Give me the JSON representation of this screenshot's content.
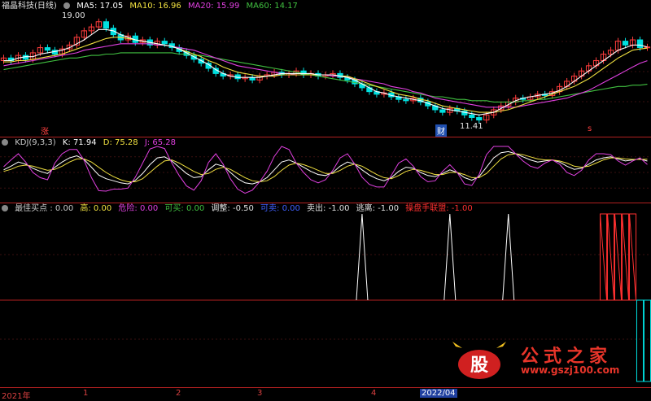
{
  "main": {
    "title": "福晶科技(日线)",
    "ma5": "MA5: 17.05",
    "ma10": "MA10: 16.96",
    "ma20": "MA20: 15.99",
    "ma60": "MA60: 14.17",
    "high_label": "19.00",
    "low_label": "11.41",
    "marker_zhang": "涨",
    "marker_cai": "财",
    "marker_s": "s"
  },
  "kdj": {
    "name": "KDJ(9,3,3)",
    "k": "K: 71.94",
    "d": "D: 75.28",
    "j": "J: 65.28"
  },
  "ind": {
    "name": "最佳买点 : 0.00",
    "gao": "高: 0.00",
    "wx": "危险: 0.00",
    "km": "可买: 0.00",
    "tz": "调整: -0.50",
    "km2": "可卖: 0.00",
    "mc": "卖出: -1.00",
    "tj": "逃离: -1.00",
    "cp": "操盘手联盟: -1.00"
  },
  "axis": {
    "labels": [
      "2021年",
      "1",
      "2",
      "3",
      "4",
      "2022/04"
    ]
  },
  "watermark": {
    "big": "公式之家",
    "url": "www.gszj100.com",
    "logo": "股"
  },
  "colors": {
    "up": "#ff3c3c",
    "down": "#00e0e0",
    "ma5": "#ffffff",
    "ma10": "#f0e040",
    "ma20": "#e040e0",
    "ma60": "#40c040"
  },
  "chart_data": [
    {
      "type": "candlestick",
      "title": "福晶科技(日线)",
      "price_range": [
        10.5,
        19.8
      ],
      "close": [
        16.2,
        16.0,
        16.4,
        16.1,
        16.6,
        17.0,
        16.8,
        16.5,
        16.9,
        17.2,
        17.8,
        18.3,
        18.6,
        19.0,
        18.5,
        18.0,
        17.6,
        17.9,
        17.4,
        17.6,
        17.2,
        17.5,
        17.3,
        17.0,
        16.7,
        16.4,
        16.1,
        15.8,
        15.4,
        15.0,
        14.8,
        14.9,
        14.6,
        14.7,
        14.5,
        14.8,
        14.9,
        15.1,
        14.9,
        15.0,
        15.2,
        14.9,
        15.0,
        14.8,
        14.9,
        15.0,
        14.7,
        14.5,
        14.2,
        13.9,
        13.6,
        13.4,
        13.5,
        13.2,
        13.0,
        12.9,
        13.1,
        12.8,
        12.5,
        12.2,
        12.0,
        12.3,
        12.1,
        11.8,
        11.6,
        11.41,
        11.8,
        12.2,
        12.5,
        12.8,
        13.1,
        13.0,
        13.2,
        13.4,
        13.3,
        13.6,
        14.0,
        14.4,
        14.8,
        15.2,
        15.6,
        16.0,
        16.5,
        16.8,
        17.5,
        17.2,
        17.6,
        17.0,
        17.05
      ],
      "ma5": [
        16.0,
        16.0,
        16.2,
        16.3,
        16.3,
        16.5,
        16.6,
        16.7,
        16.8,
        17.0,
        17.3,
        17.6,
        18.0,
        18.4,
        18.4,
        18.3,
        18.0,
        17.8,
        17.6,
        17.5,
        17.4,
        17.3,
        17.2,
        17.1,
        16.9,
        16.6,
        16.3,
        16.0,
        15.7,
        15.3,
        15.0,
        14.8,
        14.7,
        14.7,
        14.7,
        14.7,
        14.8,
        14.9,
        15.0,
        15.0,
        15.0,
        15.0,
        15.0,
        14.9,
        14.9,
        14.9,
        14.8,
        14.7,
        14.5,
        14.2,
        13.9,
        13.6,
        13.5,
        13.3,
        13.2,
        13.1,
        13.0,
        12.9,
        12.7,
        12.5,
        12.3,
        12.2,
        12.1,
        12.0,
        11.9,
        11.8,
        11.9,
        12.0,
        12.3,
        12.6,
        12.9,
        13.1,
        13.2,
        13.3,
        13.4,
        13.5,
        13.7,
        14.0,
        14.4,
        14.8,
        15.2,
        15.6,
        16.0,
        16.4,
        16.8,
        17.0,
        17.2,
        17.2,
        17.05
      ],
      "ma10": [
        15.9,
        15.9,
        16.0,
        16.0,
        16.1,
        16.2,
        16.3,
        16.4,
        16.5,
        16.7,
        16.9,
        17.1,
        17.3,
        17.5,
        17.7,
        17.8,
        17.8,
        17.7,
        17.6,
        17.5,
        17.4,
        17.3,
        17.2,
        17.1,
        16.9,
        16.7,
        16.5,
        16.3,
        16.0,
        15.8,
        15.5,
        15.3,
        15.1,
        15.0,
        14.9,
        14.8,
        14.8,
        14.8,
        14.9,
        14.9,
        14.9,
        14.9,
        14.9,
        14.9,
        14.9,
        14.9,
        14.8,
        14.8,
        14.6,
        14.4,
        14.2,
        14.0,
        13.8,
        13.6,
        13.4,
        13.3,
        13.2,
        13.0,
        12.9,
        12.7,
        12.5,
        12.4,
        12.3,
        12.2,
        12.1,
        12.0,
        12.0,
        12.0,
        12.1,
        12.2,
        12.4,
        12.6,
        12.8,
        13.0,
        13.2,
        13.4,
        13.6,
        13.8,
        14.0,
        14.3,
        14.6,
        15.0,
        15.4,
        15.8,
        16.2,
        16.5,
        16.8,
        16.9,
        16.96
      ],
      "ma20": [
        15.6,
        15.7,
        15.8,
        15.9,
        16.0,
        16.1,
        16.2,
        16.3,
        16.4,
        16.5,
        16.6,
        16.8,
        16.9,
        17.0,
        17.1,
        17.2,
        17.3,
        17.3,
        17.3,
        17.3,
        17.3,
        17.2,
        17.2,
        17.1,
        17.0,
        16.9,
        16.8,
        16.6,
        16.4,
        16.2,
        16.0,
        15.8,
        15.6,
        15.5,
        15.4,
        15.3,
        15.2,
        15.1,
        15.0,
        15.0,
        14.9,
        14.9,
        14.9,
        14.9,
        14.9,
        14.8,
        14.8,
        14.7,
        14.6,
        14.5,
        14.4,
        14.3,
        14.2,
        14.0,
        13.9,
        13.8,
        13.6,
        13.5,
        13.3,
        13.1,
        13.0,
        12.9,
        12.8,
        12.7,
        12.6,
        12.5,
        12.4,
        12.4,
        12.4,
        12.4,
        12.4,
        12.5,
        12.6,
        12.7,
        12.8,
        12.9,
        13.0,
        13.1,
        13.3,
        13.5,
        13.7,
        14.0,
        14.3,
        14.6,
        14.9,
        15.2,
        15.5,
        15.8,
        15.99
      ],
      "ma60": [
        15.3,
        15.4,
        15.5,
        15.6,
        15.7,
        15.8,
        15.9,
        16.0,
        16.1,
        16.2,
        16.2,
        16.3,
        16.4,
        16.4,
        16.5,
        16.5,
        16.6,
        16.6,
        16.6,
        16.6,
        16.6,
        16.6,
        16.6,
        16.6,
        16.5,
        16.5,
        16.4,
        16.4,
        16.3,
        16.2,
        16.1,
        16.0,
        15.9,
        15.8,
        15.7,
        15.6,
        15.5,
        15.4,
        15.3,
        15.2,
        15.1,
        15.0,
        14.9,
        14.8,
        14.7,
        14.6,
        14.5,
        14.4,
        14.3,
        14.2,
        14.1,
        14.0,
        13.9,
        13.8,
        13.7,
        13.6,
        13.5,
        13.4,
        13.3,
        13.2,
        13.2,
        13.1,
        13.0,
        13.0,
        12.9,
        12.9,
        12.9,
        12.8,
        12.8,
        12.8,
        12.8,
        12.9,
        12.9,
        13.0,
        13.0,
        13.1,
        13.2,
        13.3,
        13.4,
        13.5,
        13.6,
        13.7,
        13.8,
        13.9,
        14.0,
        14.0,
        14.1,
        14.1,
        14.17
      ]
    },
    {
      "type": "line",
      "title": "KDJ(9,3,3)",
      "ylim": [
        0,
        100
      ],
      "series": [
        {
          "name": "K",
          "values": [
            55,
            62,
            70,
            66,
            58,
            52,
            48,
            60,
            70,
            78,
            82,
            75,
            60,
            45,
            38,
            34,
            30,
            28,
            35,
            48,
            65,
            78,
            80,
            72,
            60,
            48,
            40,
            42,
            55,
            66,
            62,
            50,
            38,
            30,
            28,
            32,
            40,
            55,
            70,
            74,
            68,
            60,
            52,
            46,
            44,
            50,
            62,
            70,
            66,
            55,
            45,
            38,
            34,
            40,
            52,
            60,
            58,
            50,
            44,
            42,
            48,
            55,
            50,
            40,
            35,
            42,
            60,
            78,
            88,
            90,
            86,
            80,
            74,
            70,
            72,
            74,
            70,
            62,
            56,
            58,
            66,
            74,
            78,
            80,
            76,
            72,
            74,
            76,
            71.94
          ]
        },
        {
          "name": "D",
          "values": [
            52,
            56,
            62,
            64,
            62,
            58,
            54,
            56,
            62,
            70,
            76,
            76,
            70,
            60,
            50,
            42,
            36,
            32,
            32,
            38,
            50,
            62,
            72,
            74,
            68,
            60,
            52,
            46,
            48,
            56,
            60,
            56,
            48,
            40,
            34,
            32,
            34,
            42,
            54,
            64,
            68,
            65,
            60,
            54,
            48,
            48,
            54,
            62,
            66,
            62,
            54,
            46,
            40,
            38,
            44,
            52,
            56,
            54,
            50,
            46,
            46,
            50,
            50,
            46,
            40,
            40,
            48,
            62,
            76,
            84,
            86,
            84,
            80,
            76,
            74,
            74,
            72,
            68,
            62,
            60,
            62,
            68,
            74,
            78,
            78,
            76,
            75,
            75,
            75.28
          ]
        },
        {
          "name": "J",
          "values": [
            61,
            74,
            86,
            70,
            50,
            40,
            36,
            68,
            86,
            94,
            94,
            73,
            40,
            15,
            14,
            18,
            18,
            20,
            41,
            68,
            95,
            100,
            96,
            68,
            44,
            24,
            16,
            34,
            69,
            86,
            66,
            38,
            18,
            10,
            16,
            32,
            52,
            81,
            100,
            94,
            68,
            50,
            36,
            30,
            36,
            54,
            78,
            86,
            66,
            41,
            27,
            22,
            22,
            44,
            68,
            76,
            62,
            42,
            32,
            34,
            52,
            65,
            50,
            28,
            25,
            46,
            84,
            100,
            100,
            100,
            86,
            72,
            62,
            58,
            68,
            74,
            66,
            50,
            44,
            54,
            74,
            86,
            86,
            84,
            72,
            64,
            72,
            78,
            65.28
          ]
        }
      ]
    },
    {
      "type": "line",
      "title": "最佳买点",
      "ylim": [
        -1.5,
        1.5
      ],
      "series": [
        {
          "name": "最佳买点",
          "values": [
            0,
            0,
            0,
            0,
            0,
            0,
            0,
            0,
            0,
            0,
            0,
            0,
            0,
            0,
            0,
            0,
            0,
            0,
            0,
            0,
            0,
            0,
            0,
            0,
            0,
            0,
            0,
            0,
            0,
            0,
            0,
            0,
            0,
            0,
            0,
            0,
            0,
            0,
            0,
            0,
            0,
            0,
            0,
            0,
            0,
            0,
            0,
            0,
            0,
            1,
            0,
            0,
            0,
            0,
            0,
            0,
            0,
            0,
            0,
            0,
            0,
            1,
            0,
            0,
            0,
            0,
            0,
            0,
            0,
            1,
            0,
            0,
            0,
            0,
            0,
            0,
            0,
            0,
            0,
            0,
            0,
            0,
            0,
            0,
            0,
            0,
            0,
            0,
            0
          ]
        },
        {
          "name": "操盘手联盟",
          "values": [
            0,
            0,
            0,
            0,
            0,
            0,
            0,
            0,
            0,
            0,
            0,
            0,
            0,
            0,
            0,
            0,
            0,
            0,
            0,
            0,
            0,
            0,
            0,
            0,
            0,
            0,
            0,
            0,
            0,
            0,
            0,
            0,
            0,
            0,
            0,
            0,
            0,
            0,
            0,
            0,
            0,
            0,
            0,
            0,
            0,
            0,
            0,
            0,
            0,
            0,
            0,
            0,
            0,
            0,
            0,
            0,
            0,
            0,
            0,
            0,
            0,
            0,
            0,
            0,
            0,
            0,
            0,
            0,
            0,
            0,
            0,
            0,
            0,
            0,
            0,
            0,
            0,
            0,
            0,
            0,
            0,
            0,
            1,
            1,
            1,
            1,
            1,
            -1,
            -1
          ]
        }
      ]
    }
  ]
}
